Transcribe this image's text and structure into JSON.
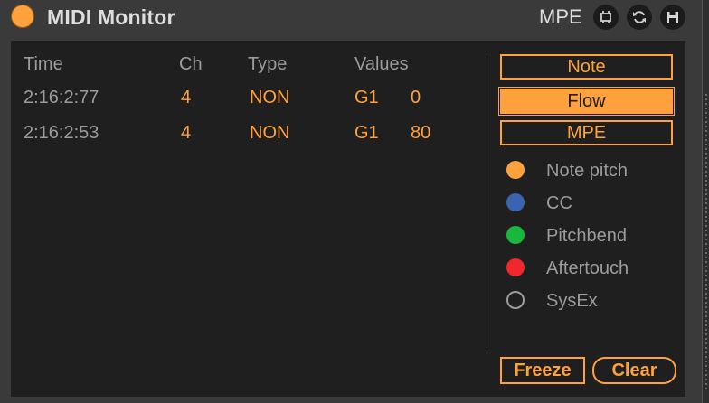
{
  "window": {
    "title": "MIDI Monitor",
    "mode_tag": "MPE"
  },
  "icons": {
    "power": "power-toggle-icon",
    "resize": "resize-icon",
    "refresh": "refresh-icon",
    "save": "save-icon"
  },
  "table": {
    "headers": {
      "time": "Time",
      "ch": "Ch",
      "type": "Type",
      "values": "Values"
    },
    "rows": [
      {
        "time": "2:16:2:77",
        "ch": "4",
        "type": "NON",
        "note": "G1",
        "value": "0"
      },
      {
        "time": "2:16:2:53",
        "ch": "4",
        "type": "NON",
        "note": "G1",
        "value": "80"
      }
    ]
  },
  "modes": {
    "note": "Note",
    "flow": "Flow",
    "mpe": "MPE",
    "selected": "Flow"
  },
  "legend": [
    {
      "label": "Note pitch",
      "color": "#ffa13d"
    },
    {
      "label": "CC",
      "color": "#3a64b0"
    },
    {
      "label": "Pitchbend",
      "color": "#19b83c"
    },
    {
      "label": "Aftertouch",
      "color": "#f0272b"
    },
    {
      "label": "SysEx",
      "color": "outline"
    }
  ],
  "actions": {
    "freeze": "Freeze",
    "clear": "Clear"
  },
  "colors": {
    "accent": "#ffa13d",
    "panel": "#1f1f1f",
    "chrome": "#3a3a3a",
    "muted_text": "#9c9c9c"
  }
}
